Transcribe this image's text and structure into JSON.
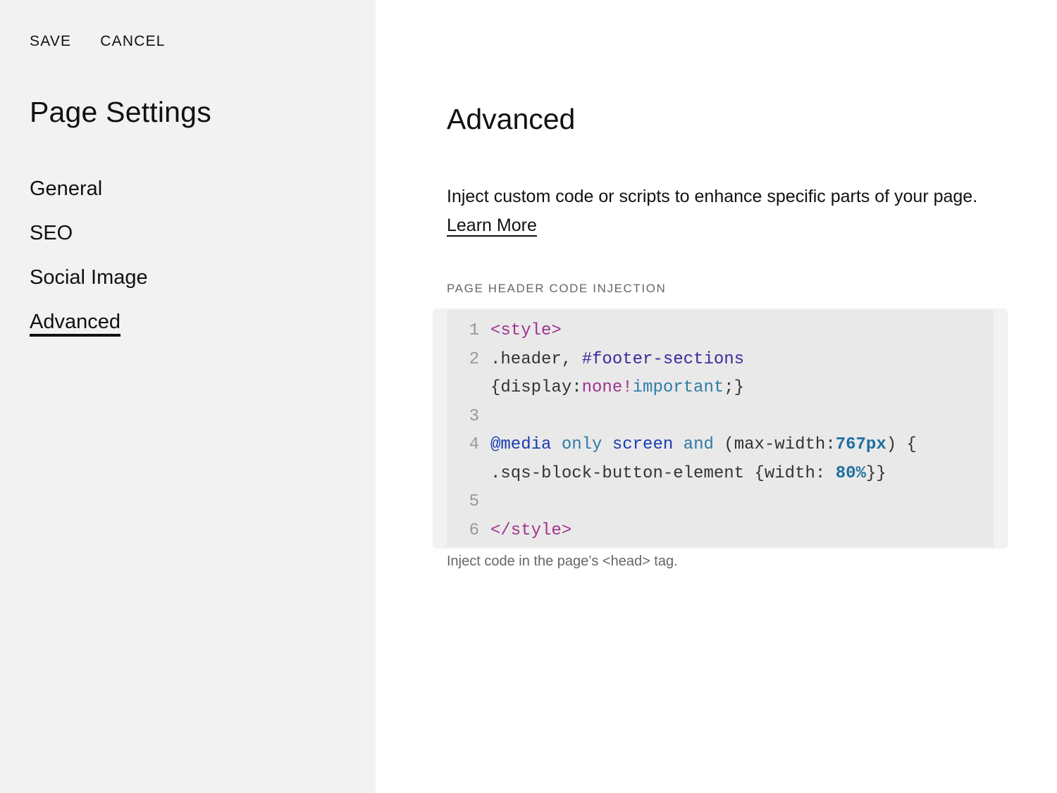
{
  "toolbar": {
    "save_label": "SAVE",
    "cancel_label": "CANCEL"
  },
  "sidebar": {
    "title": "Page Settings",
    "items": [
      {
        "label": "General",
        "active": false
      },
      {
        "label": "SEO",
        "active": false
      },
      {
        "label": "Social Image",
        "active": false
      },
      {
        "label": "Advanced",
        "active": true
      }
    ]
  },
  "main": {
    "title": "Advanced",
    "description": "Inject custom code or scripts to enhance specific parts of your page. ",
    "learn_more": "Learn More",
    "section_label": "PAGE HEADER CODE INJECTION",
    "code_lines": [
      {
        "num": "1",
        "text": "<style>"
      },
      {
        "num": "2",
        "text": ".header, #footer-sections"
      },
      {
        "num": "",
        "text": "{display:none!important;}"
      },
      {
        "num": "3",
        "text": ""
      },
      {
        "num": "4",
        "text": "@media only screen and (max-width:767px) {"
      },
      {
        "num": "",
        "text": ".sqs-block-button-element {width: 80%}}"
      },
      {
        "num": "5",
        "text": ""
      },
      {
        "num": "6",
        "text": "</style>"
      }
    ],
    "helper_text": "Inject code in the page’s <head> tag."
  },
  "colors": {
    "sidebar_bg": "#f2f2f2",
    "code_bg": "#e9e9e9",
    "tag": "#a0338f",
    "keyword": "#2f7aa6",
    "at_rule": "#1a3cb0"
  }
}
